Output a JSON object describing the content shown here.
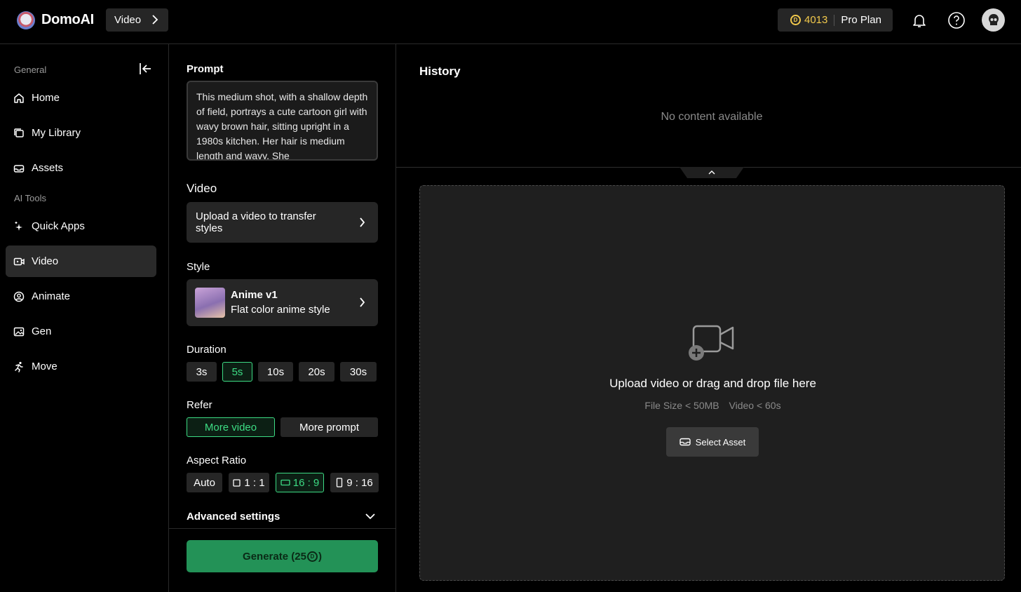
{
  "header": {
    "brand": "DomoAI",
    "breadcrumb": "Video",
    "credits": "4013",
    "plan": "Pro Plan"
  },
  "sidebar": {
    "section_general": "General",
    "section_ai_tools": "AI Tools",
    "items": [
      {
        "label": "Home",
        "icon": "home-icon"
      },
      {
        "label": "My Library",
        "icon": "library-icon"
      },
      {
        "label": "Assets",
        "icon": "assets-icon"
      },
      {
        "label": "Quick Apps",
        "icon": "sparkle-icon"
      },
      {
        "label": "Video",
        "icon": "video-icon",
        "active": true
      },
      {
        "label": "Animate",
        "icon": "animate-icon"
      },
      {
        "label": "Gen",
        "icon": "image-icon"
      },
      {
        "label": "Move",
        "icon": "running-icon"
      }
    ]
  },
  "panel": {
    "prompt_label": "Prompt",
    "prompt_text": "This medium shot, with a shallow depth of field, portrays a cute cartoon girl with wavy brown hair, sitting upright in a 1980s kitchen. Her hair is medium length and wavy. She",
    "video_label": "Video",
    "video_upload": "Upload a video to transfer styles",
    "style_label": "Style",
    "style_name": "Anime v1",
    "style_desc": "Flat color anime style",
    "duration_label": "Duration",
    "durations": [
      "3s",
      "5s",
      "10s",
      "20s",
      "30s"
    ],
    "duration_selected": "5s",
    "refer_label": "Refer",
    "refer_options": [
      "More video",
      "More prompt"
    ],
    "refer_selected": "More video",
    "aspect_label": "Aspect Ratio",
    "aspects": [
      "Auto",
      "1 : 1",
      "16 : 9",
      "9 : 16"
    ],
    "aspect_selected": "16 : 9",
    "advanced_label": "Advanced settings",
    "generate_label": "Generate (25",
    "generate_suffix": ")"
  },
  "main": {
    "history_title": "History",
    "empty_text": "No content available",
    "upload_title": "Upload video or drag and drop file here",
    "file_size": "File Size < 50MB",
    "video_len": "Video < 60s",
    "select_asset": "Select Asset"
  },
  "colors": {
    "accent": "#3ddc84",
    "generate_bg": "#239257",
    "coin": "#f2c94c"
  }
}
